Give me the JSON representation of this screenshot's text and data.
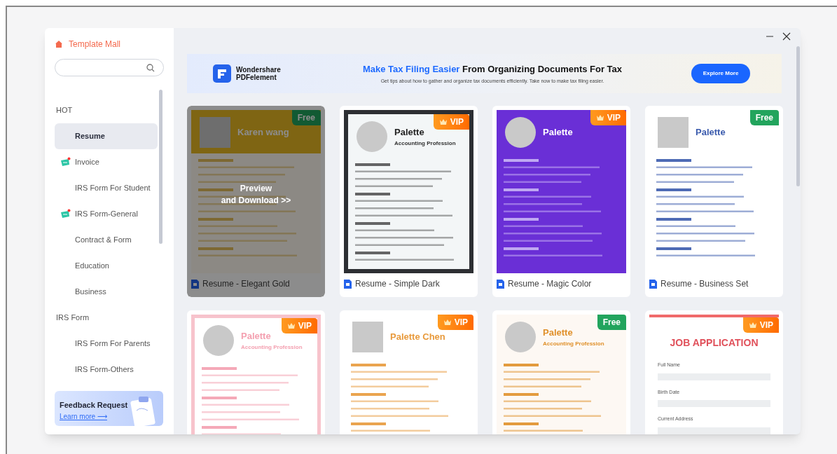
{
  "sidebar": {
    "title": "Template Mall",
    "groups": [
      {
        "label": "HOT",
        "children": [
          {
            "label": "Resume",
            "selected": true,
            "new_badge": false
          },
          {
            "label": "Invoice",
            "selected": false,
            "new_badge": true
          },
          {
            "label": "IRS Form For Student",
            "selected": false,
            "new_badge": false
          },
          {
            "label": "IRS Form-General",
            "selected": false,
            "new_badge": true
          },
          {
            "label": "Contract & Form",
            "selected": false,
            "new_badge": false
          },
          {
            "label": "Education",
            "selected": false,
            "new_badge": false
          },
          {
            "label": "Business",
            "selected": false,
            "new_badge": false
          }
        ]
      },
      {
        "label": "IRS Form",
        "children": [
          {
            "label": "IRS Form For Parents",
            "selected": false,
            "new_badge": false
          },
          {
            "label": "IRS Form-Others",
            "selected": false,
            "new_badge": false
          }
        ]
      }
    ],
    "feedback": {
      "title": "Feedback Request",
      "link": "Learn more ⟶"
    }
  },
  "banner": {
    "brand": [
      "Wondershare",
      "PDFelement"
    ],
    "headline": {
      "highlight": "Make Tax Filing Easier",
      "rest": " From Organizing Documents For Tax"
    },
    "subtitle": "Get tips about how to gather and organize tax documents efficiently.  Take now to make tax filing easier.",
    "button": "Explore More"
  },
  "templates": [
    {
      "title": "Resume - Elegant Gold",
      "badge": {
        "kind": "free",
        "label": "Free"
      },
      "kind": "gold",
      "heading": "Karen wang",
      "hovered": true,
      "overlay": "Preview\nand Download >>"
    },
    {
      "title": "Resume - Simple Dark",
      "badge": {
        "kind": "vip",
        "label": "VIP"
      },
      "kind": "dark",
      "heading": "Palette",
      "subheading": "Accounting Profession",
      "hovered": false
    },
    {
      "title": "Resume - Magic Color",
      "badge": {
        "kind": "vip",
        "label": "VIP"
      },
      "kind": "purple",
      "heading": "Palette",
      "hovered": false
    },
    {
      "title": "Resume - Business Set",
      "badge": {
        "kind": "free",
        "label": "Free"
      },
      "kind": "blue",
      "heading": "Palette",
      "hovered": false
    },
    {
      "badge": {
        "kind": "vip",
        "label": "VIP"
      },
      "kind": "pink",
      "heading": "Palette",
      "subheading": "Accounting Profession",
      "hovered": false
    },
    {
      "badge": {
        "kind": "vip",
        "label": "VIP"
      },
      "kind": "orange",
      "heading": "Palette Chen",
      "hovered": false
    },
    {
      "badge": {
        "kind": "free",
        "label": "Free"
      },
      "kind": "cream",
      "heading": "Palette",
      "subheading": "Accounting Profession",
      "hovered": false
    },
    {
      "badge": {
        "kind": "vip",
        "label": "VIP"
      },
      "kind": "form",
      "heading": "JOB APPLICATION",
      "fields": [
        "Full Name",
        "Birth Date",
        "Current Address"
      ],
      "hovered": false
    }
  ]
}
